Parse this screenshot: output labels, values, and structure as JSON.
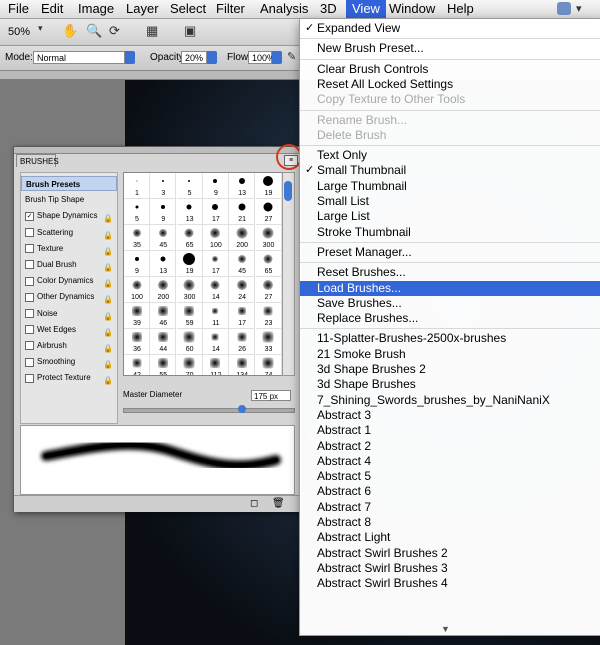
{
  "menubar": {
    "items": [
      "File",
      "Edit",
      "Image",
      "Layer",
      "Select",
      "Filter",
      "Analysis",
      "3D",
      "View",
      "Window",
      "Help"
    ],
    "active_index": 8
  },
  "options": {
    "zoom": "50%",
    "mode_label": "Mode:",
    "mode_value": "Normal",
    "opacity_label": "Opacity:",
    "opacity_value": "20%",
    "flow_label": "Flow:",
    "flow_value": "100%"
  },
  "panel": {
    "tab": "BRUSHES",
    "left_items": [
      {
        "label": "Brush Presets",
        "type": "header"
      },
      {
        "label": "Brush Tip Shape",
        "type": "plain"
      },
      {
        "label": "Shape Dynamics",
        "type": "check",
        "checked": true
      },
      {
        "label": "Scattering",
        "type": "check",
        "checked": false
      },
      {
        "label": "Texture",
        "type": "check",
        "checked": false
      },
      {
        "label": "Dual Brush",
        "type": "check",
        "checked": false
      },
      {
        "label": "Color Dynamics",
        "type": "check",
        "checked": false
      },
      {
        "label": "Other Dynamics",
        "type": "check",
        "checked": false
      },
      {
        "label": "Noise",
        "type": "check",
        "checked": false
      },
      {
        "label": "Wet Edges",
        "type": "check",
        "checked": false
      },
      {
        "label": "Airbrush",
        "type": "check",
        "checked": false
      },
      {
        "label": "Smoothing",
        "type": "check",
        "checked": false
      },
      {
        "label": "Protect Texture",
        "type": "check",
        "checked": false
      }
    ],
    "brush_numbers": [
      [
        "1",
        "3",
        "5",
        "9",
        "13",
        "19"
      ],
      [
        "5",
        "9",
        "13",
        "17",
        "21",
        "27"
      ],
      [
        "35",
        "45",
        "65",
        "100",
        "200",
        "300"
      ],
      [
        "9",
        "13",
        "19",
        "17",
        "45",
        "65"
      ],
      [
        "100",
        "200",
        "300",
        "14",
        "24",
        "27"
      ],
      [
        "39",
        "46",
        "59",
        "11",
        "17",
        "23"
      ],
      [
        "36",
        "44",
        "60",
        "14",
        "26",
        "33"
      ],
      [
        "42",
        "55",
        "70",
        "112",
        "134",
        "74"
      ]
    ],
    "master_diameter_label": "Master Diameter",
    "master_diameter_value": "175 px"
  },
  "menu": {
    "items": [
      {
        "label": "Expanded View",
        "checked": true
      },
      {
        "sep": true
      },
      {
        "label": "New Brush Preset..."
      },
      {
        "sep": true
      },
      {
        "label": "Clear Brush Controls"
      },
      {
        "label": "Reset All Locked Settings"
      },
      {
        "label": "Copy Texture to Other Tools",
        "disabled": true
      },
      {
        "sep": true
      },
      {
        "label": "Rename Brush...",
        "disabled": true
      },
      {
        "label": "Delete Brush",
        "disabled": true
      },
      {
        "sep": true
      },
      {
        "label": "Text Only"
      },
      {
        "label": "Small Thumbnail",
        "checked": true
      },
      {
        "label": "Large Thumbnail"
      },
      {
        "label": "Small List"
      },
      {
        "label": "Large List"
      },
      {
        "label": "Stroke Thumbnail"
      },
      {
        "sep": true
      },
      {
        "label": "Preset Manager..."
      },
      {
        "sep": true
      },
      {
        "label": "Reset Brushes..."
      },
      {
        "label": "Load Brushes...",
        "highlighted": true
      },
      {
        "label": "Save Brushes..."
      },
      {
        "label": "Replace Brushes..."
      },
      {
        "sep": true
      },
      {
        "label": "11-Splatter-Brushes-2500x-brushes"
      },
      {
        "label": "21 Smoke Brush"
      },
      {
        "label": "3d Shape Brushes 2"
      },
      {
        "label": "3d Shape Brushes"
      },
      {
        "label": "7_Shining_Swords_brushes_by_NaniNaniX"
      },
      {
        "label": "Abstract 3"
      },
      {
        "label": "Abstract 1"
      },
      {
        "label": "Abstract 2"
      },
      {
        "label": "Abstract 4"
      },
      {
        "label": "Abstract 5"
      },
      {
        "label": "Abstract 6"
      },
      {
        "label": "Abstract 7"
      },
      {
        "label": "Abstract 8"
      },
      {
        "label": "Abstract Light"
      },
      {
        "label": "Abstract Swirl Brushes 2"
      },
      {
        "label": "Abstract Swirl Brushes 3"
      },
      {
        "label": "Abstract Swirl Brushes 4"
      }
    ]
  }
}
